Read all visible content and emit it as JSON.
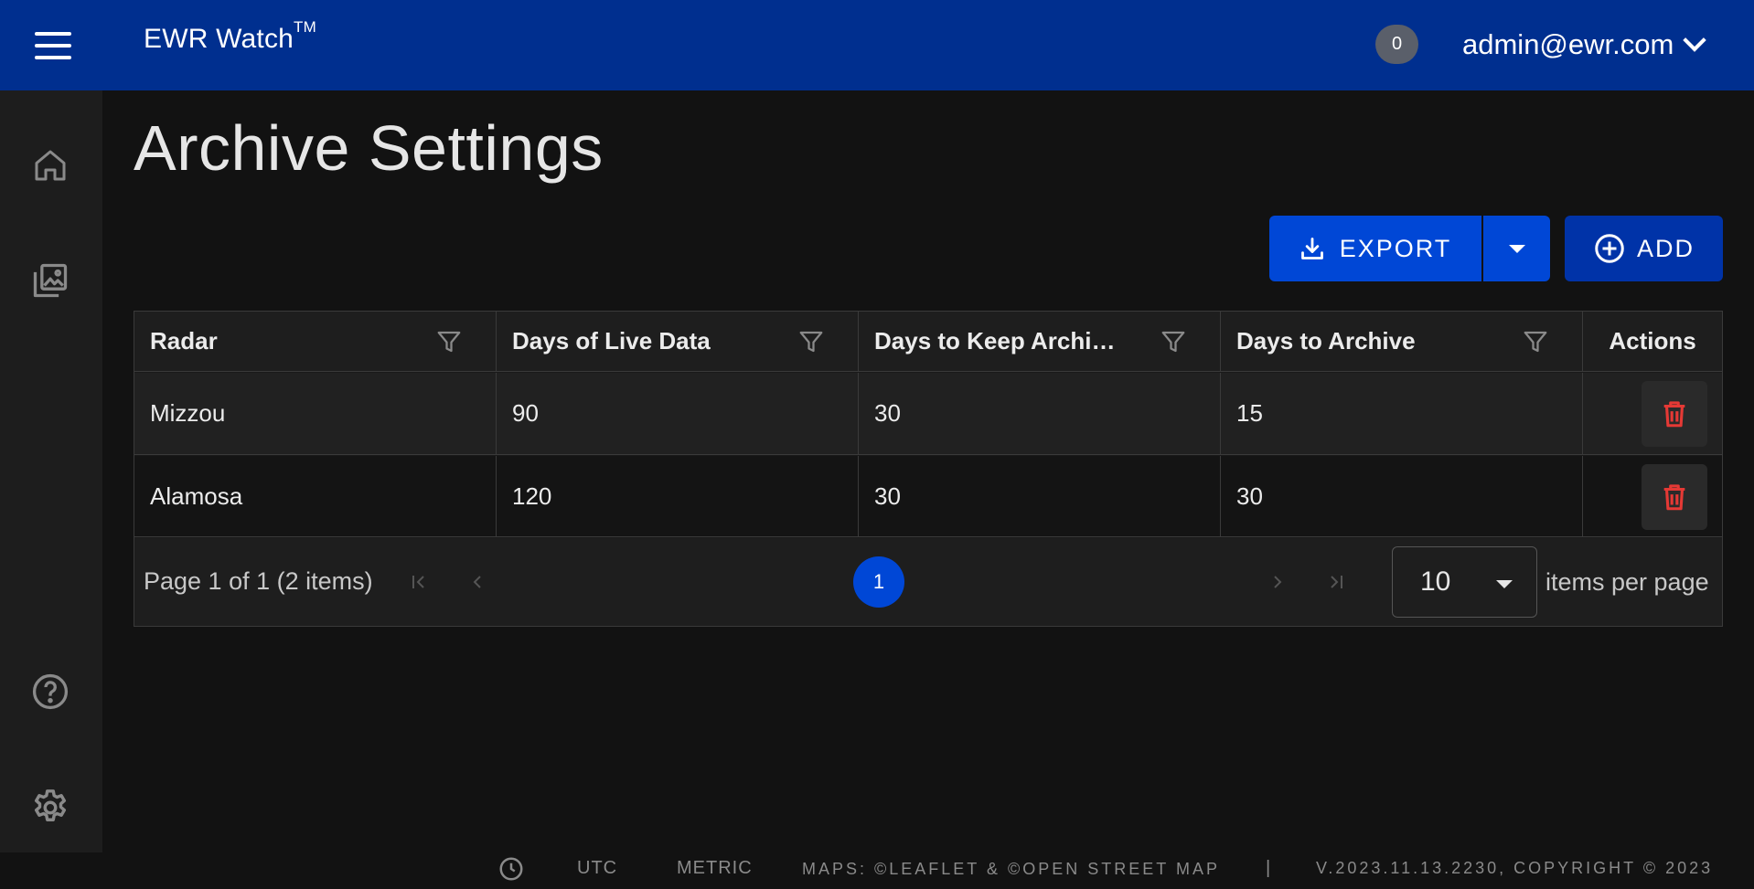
{
  "header": {
    "app_name": "EWR Watch",
    "trademark": "TM",
    "notification_count": "0",
    "user": "admin@ewr.com"
  },
  "sidebar": {
    "items": [
      {
        "icon": "home-icon"
      },
      {
        "icon": "gallery-icon"
      },
      {
        "icon": "help-icon"
      },
      {
        "icon": "gear-icon"
      }
    ]
  },
  "page": {
    "title": "Archive Settings",
    "export_label": "EXPORT",
    "add_label": "ADD"
  },
  "grid": {
    "columns": [
      "Radar",
      "Days of Live Data",
      "Days to Keep Archi…",
      "Days to Archive",
      "Actions"
    ],
    "rows": [
      {
        "radar": "Mizzou",
        "live": "90",
        "keep": "30",
        "archive": "15"
      },
      {
        "radar": "Alamosa",
        "live": "120",
        "keep": "30",
        "archive": "30"
      }
    ]
  },
  "pager": {
    "info": "Page 1 of 1 (2 items)",
    "current_page": "1",
    "page_size": "10",
    "per_page_label": "items per page"
  },
  "footer": {
    "timezone": "UTC",
    "units": "METRIC",
    "maps": "MAPS: ©LEAFLET & ©OPEN STREET MAP",
    "separator": "|",
    "version": "V.2023.11.13.2230, COPYRIGHT © 2023"
  },
  "colors": {
    "header_bg": "#002f8f",
    "primary": "#0047d6",
    "danger": "#e53935"
  }
}
